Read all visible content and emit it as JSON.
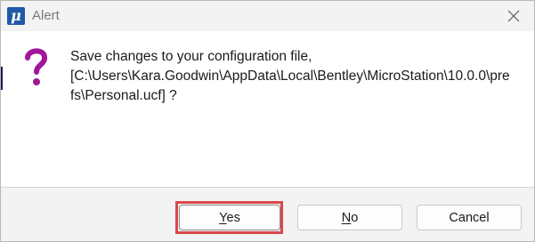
{
  "window": {
    "title": "Alert",
    "app_icon_glyph": "μ"
  },
  "message": {
    "line1": "Save changes to your configuration file,",
    "line2": "[C:\\Users\\Kara.Goodwin\\AppData\\Local\\Bentley\\MicroStation\\10.0.0\\pre",
    "line3": "fs\\Personal.ucf] ?"
  },
  "icon": {
    "name": "question-icon",
    "color": "#a0179a"
  },
  "buttons": {
    "yes": {
      "mnemonic": "Y",
      "rest": "es",
      "highlighted": true,
      "highlight_color": "#d9474b"
    },
    "no": {
      "mnemonic": "N",
      "rest": "o"
    },
    "cancel": {
      "label": "Cancel"
    }
  },
  "close_icon": "close-icon"
}
